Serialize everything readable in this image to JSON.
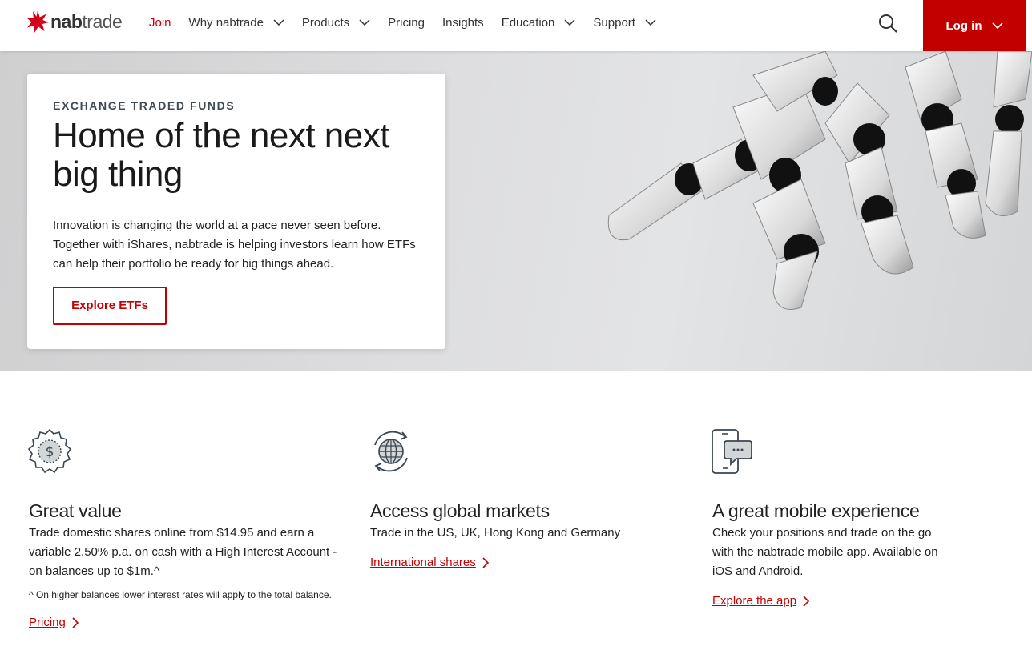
{
  "brand": {
    "logo_nab": "nab",
    "logo_trade": "trade",
    "accent_color": "#c20000"
  },
  "nav": {
    "items": [
      {
        "label": "Join",
        "dropdown": false
      },
      {
        "label": "Why nabtrade",
        "dropdown": true
      },
      {
        "label": "Products",
        "dropdown": true
      },
      {
        "label": "Pricing",
        "dropdown": false
      },
      {
        "label": "Insights",
        "dropdown": false
      },
      {
        "label": "Education",
        "dropdown": true
      },
      {
        "label": "Support",
        "dropdown": true
      }
    ],
    "search_icon": "search-icon",
    "login_label": "Log in"
  },
  "hero": {
    "eyebrow": "EXCHANGE TRADED FUNDS",
    "title": "Home of the next next big thing",
    "text": "Innovation is changing the world at a pace never seen before. Together with iShares, nabtrade is helping investors learn how ETFs can help their portfolio be ready for big things ahead.",
    "cta_label": "Explore ETFs",
    "image": "robot-hand-image"
  },
  "features": [
    {
      "icon": "dollar-badge-icon",
      "title": "Great value",
      "description": "Trade domestic shares online from $14.95 and earn a variable 2.50% p.a. on cash with a High Interest Account - on balances up to $1m.^",
      "note": "^ On higher balances lower interest rates will apply to the total balance.",
      "link_label": "Pricing"
    },
    {
      "icon": "globe-icon",
      "title": "Access global markets",
      "description": "Trade in the US, UK, Hong Kong and Germany",
      "link_label": "International shares"
    },
    {
      "icon": "mobile-chat-icon",
      "title": "A great mobile experience",
      "description": "Check your positions and trade on the go with the nabtrade mobile app. Available on iOS and Android.",
      "link_label": "Explore the app"
    }
  ]
}
